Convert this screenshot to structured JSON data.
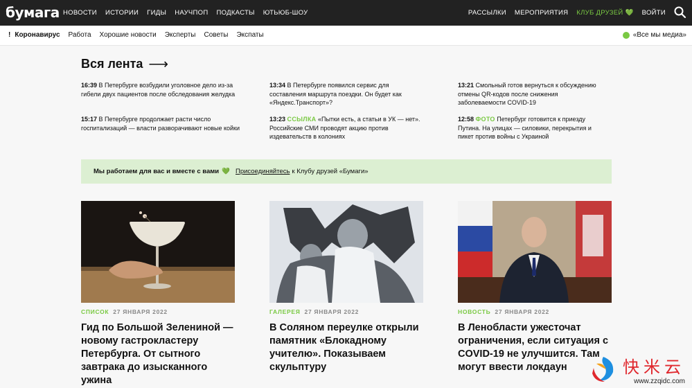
{
  "header": {
    "logo": "бумага",
    "nav_left": [
      "Новости",
      "Истории",
      "Гиды",
      "Научпоп",
      "Подкасты",
      "Ютьюб-шоу"
    ],
    "nav_right": [
      "Рассылки",
      "Мероприятия",
      "Клуб друзей 💚",
      "Войти"
    ]
  },
  "subnav": {
    "items": [
      "Коронавирус",
      "Работа",
      "Хорошие новости",
      "Эксперты",
      "Советы",
      "Экспаты"
    ],
    "right": "«Все мы медиа»"
  },
  "feed": {
    "title": "Вся лента",
    "arrow": "⟶",
    "items": [
      {
        "time": "16:39",
        "kind": "",
        "text": "В Петербурге возбудили уголовное дело из-за гибели двух пациентов после обследования желудка"
      },
      {
        "time": "15:17",
        "kind": "",
        "text": "В Петербурге продолжает расти число госпитализаций — власти разворачивают новые койки"
      },
      {
        "time": "13:34",
        "kind": "",
        "text": "В Петербурге появился сервис для составления маршрута поездки. Он будет как «Яндекс.Транспорт»?"
      },
      {
        "time": "13:23",
        "kind": "ССЫЛКА",
        "text": "«Пытки есть, а статьи в УК — нет». Российские СМИ проводят акцию против издевательств в колониях"
      },
      {
        "time": "13:21",
        "kind": "",
        "text": "Смольный готов вернуться к обсуждению отмены QR-кодов после снижения заболеваемости COVID-19"
      },
      {
        "time": "12:58",
        "kind": "ФОТО",
        "text": "Петербург готовится к приезду Путина. На улицах — силовики, перекрытия и пикет против войны с Украиной"
      }
    ]
  },
  "banner": {
    "bold": "Мы работаем для вас и вместе с вами",
    "heart": "💚",
    "link": "Присоединяйтесь",
    "rest": "к Клубу друзей «Бумаги»"
  },
  "cards": [
    {
      "category": "Список",
      "date": "27 января 2022",
      "title": "Гид по Большой Зелениной — новому гастрокластеру Петербурга. От сытного завтрака до изысканного ужина"
    },
    {
      "category": "Галерея",
      "date": "27 января 2022",
      "title": "В Соляном переулке открыли памятник «Блокадному учителю». Показываем скульптуру"
    },
    {
      "category": "Новость",
      "date": "27 января 2022",
      "title": "В Ленобласти ужесточат ограничения, если ситуация с COVID-19 не улучшится. Там могут ввести локдаун"
    }
  ],
  "watermark": {
    "cn": "快米云",
    "url": "www.zzqidc.com"
  },
  "colors": {
    "accent": "#7ac943",
    "topbar": "#222222",
    "banner": "#dcefd2",
    "alert": "#d9161e"
  }
}
